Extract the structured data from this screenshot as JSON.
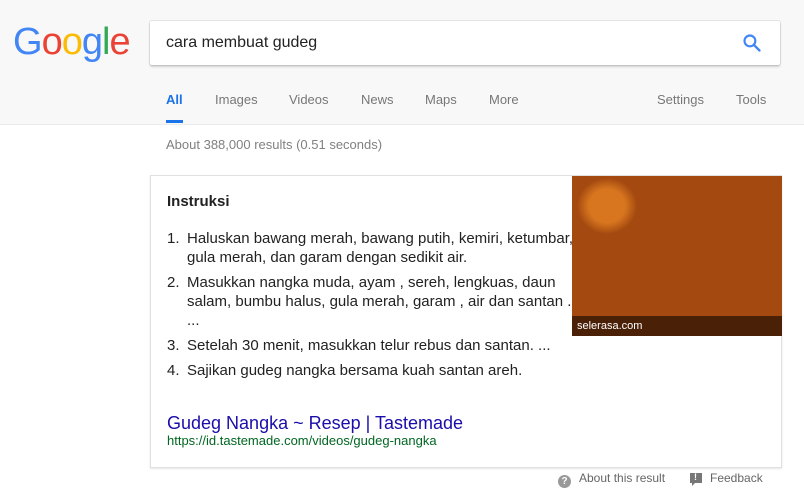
{
  "logo": [
    "G",
    "o",
    "o",
    "g",
    "l",
    "e"
  ],
  "search": {
    "query": "cara membuat gudeg",
    "icon": "search-icon"
  },
  "tabs": [
    {
      "label": "All",
      "active": true
    },
    {
      "label": "Images"
    },
    {
      "label": "Videos"
    },
    {
      "label": "News"
    },
    {
      "label": "Maps"
    },
    {
      "label": "More"
    }
  ],
  "right_tabs": [
    {
      "label": "Settings"
    },
    {
      "label": "Tools"
    }
  ],
  "stats": "About 388,000 results (0.51 seconds)",
  "featured": {
    "title": "Instruksi",
    "steps": [
      {
        "num": "1.",
        "text": "Haluskan bawang merah, bawang putih, kemiri, ketumbar, gula merah, dan garam dengan sedikit air."
      },
      {
        "num": "2.",
        "text": "Masukkan nangka muda, ayam , sereh, lengkuas, daun salam, bumbu halus, gula merah, garam , air dan santan . ..."
      },
      {
        "num": "3.",
        "text": "Setelah 30 menit, masukkan telur rebus dan santan. ..."
      },
      {
        "num": "4.",
        "text": "Sajikan gudeg nangka bersama kuah santan areh."
      }
    ],
    "image_caption": "selerasa.com",
    "link_title": "Gudeg Nangka ~ Resep | Tastemade",
    "link_url": "https://id.tastemade.com/videos/gudeg-nangka"
  },
  "footer": {
    "about": "About this result",
    "feedback": "Feedback"
  },
  "colors": {
    "link": "#1a0dab",
    "url": "#006621",
    "accent": "#1a73e8"
  }
}
